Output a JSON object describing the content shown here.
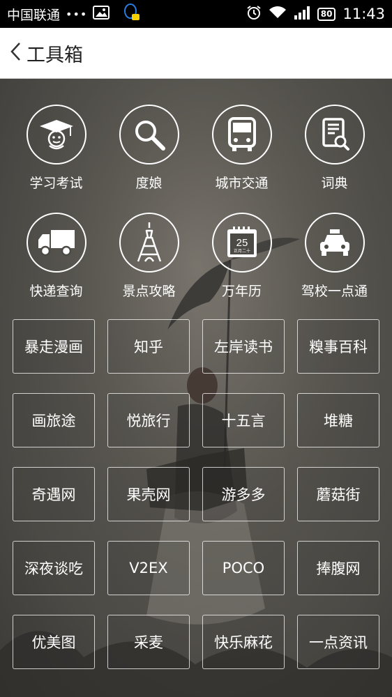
{
  "status_bar": {
    "carrier": "中国联通",
    "dots": "•••",
    "battery": "80",
    "time": "11:43"
  },
  "header": {
    "title": "工具箱"
  },
  "icon_tools": [
    {
      "label": "学习考试",
      "icon": "graduation-cap-icon"
    },
    {
      "label": "度娘",
      "icon": "search-icon"
    },
    {
      "label": "城市交通",
      "icon": "bus-icon"
    },
    {
      "label": "词典",
      "icon": "dictionary-icon"
    },
    {
      "label": "快递查询",
      "icon": "delivery-truck-icon"
    },
    {
      "label": "景点攻略",
      "icon": "eiffel-tower-icon"
    },
    {
      "label": "万年历",
      "icon": "calendar-icon",
      "date_number": "25",
      "date_text": "正月二十"
    },
    {
      "label": "驾校一点通",
      "icon": "car-icon"
    }
  ],
  "link_buttons": [
    "暴走漫画",
    "知乎",
    "左岸读书",
    "糗事百科",
    "画旅途",
    "悦旅行",
    "十五言",
    "堆糖",
    "奇遇网",
    "果壳网",
    "游多多",
    "蘑菇街",
    "深夜谈吃",
    "V2EX",
    "POCO",
    "捧腹网",
    "优美图",
    "采麦",
    "快乐麻花",
    "一点资讯"
  ]
}
